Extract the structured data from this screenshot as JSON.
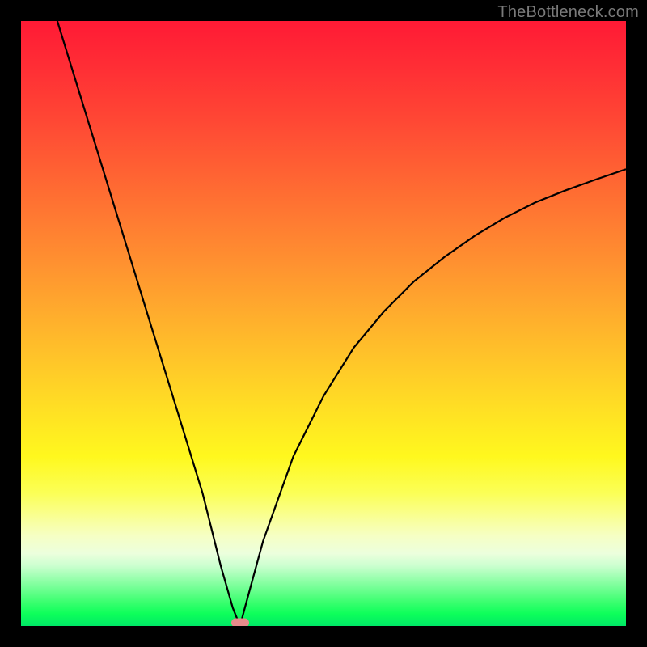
{
  "watermark": "TheBottleneck.com",
  "chart_data": {
    "type": "line",
    "title": "",
    "xlabel": "",
    "ylabel": "",
    "xlim": [
      0,
      100
    ],
    "ylim": [
      0,
      100
    ],
    "grid": false,
    "series": [
      {
        "name": "bottleneck-curve",
        "x": [
          6,
          10,
          14,
          18,
          22,
          26,
          30,
          33,
          35,
          36.2,
          37,
          40,
          45,
          50,
          55,
          60,
          65,
          70,
          75,
          80,
          85,
          90,
          95,
          100
        ],
        "y": [
          100,
          87,
          74,
          61,
          48,
          35,
          22,
          10,
          3,
          0,
          3,
          14,
          28,
          38,
          46,
          52,
          57,
          61,
          64.5,
          67.5,
          70,
          72,
          73.8,
          75.5
        ]
      }
    ],
    "annotations": [
      {
        "type": "marker",
        "name": "optimal-point",
        "x": 36.2,
        "y": 0.6
      }
    ],
    "background_gradient": {
      "top_color": "#ff1a35",
      "bottom_color": "#00e866",
      "description": "red-to-green vertical gradient (bottleneck severity)"
    }
  }
}
